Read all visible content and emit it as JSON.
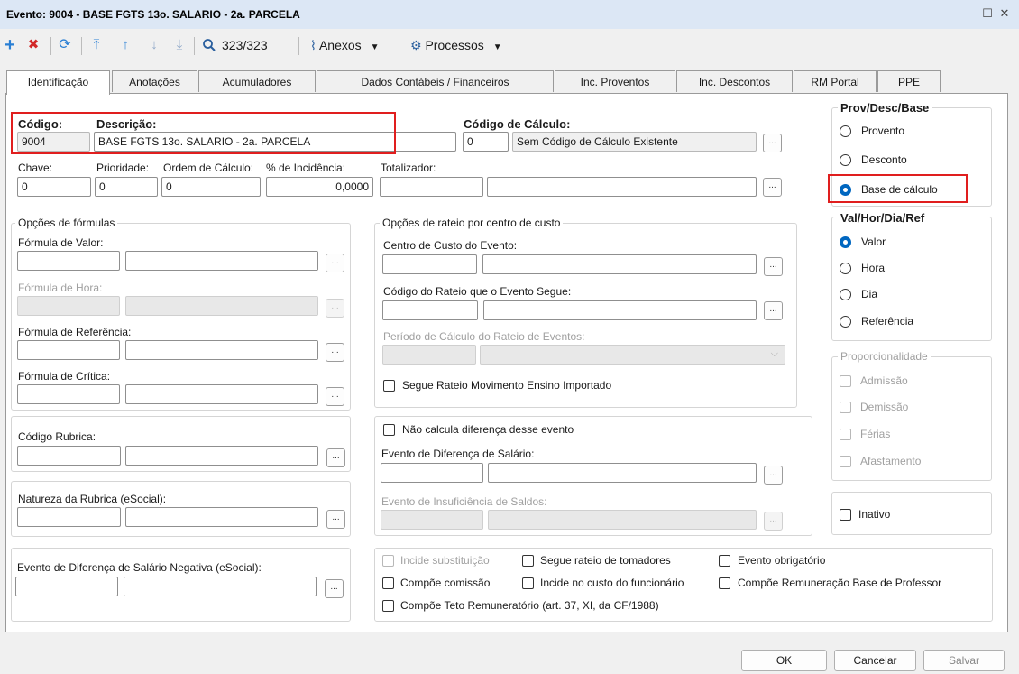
{
  "window": {
    "title": "Evento: 9004 - BASE FGTS 13o. SALARIO - 2a. PARCELA",
    "restore_glyph": "☐",
    "close_glyph": "✕"
  },
  "toolbar": {
    "add": "+",
    "delete": "✖",
    "refresh": "⟳",
    "first": "⤒",
    "prev": "↑",
    "next": "↓",
    "last": "⤓",
    "search_icon": "🔍",
    "record_count": "323/323",
    "attachments_label": "Anexos",
    "processes_label": "Processos",
    "dropdown_glyph": "▼",
    "colors": {
      "add": "#2a7fd4",
      "delete": "#d22828",
      "nav": "#2a7fd4"
    }
  },
  "tabs": [
    "Identificação",
    "Anotações",
    "Acumuladores",
    "Dados Contábeis / Financeiros",
    "Inc. Proventos",
    "Inc. Descontos",
    "RM Portal",
    "PPE"
  ],
  "ident": {
    "codigo_label": "Código:",
    "codigo_value": "9004",
    "descricao_label": "Descrição:",
    "descricao_value": "BASE FGTS 13o. SALARIO - 2a. PARCELA",
    "calc_label": "Código de Cálculo:",
    "calc_code": "0",
    "calc_desc": "Sem Código de Cálculo Existente",
    "chave_label": "Chave:",
    "chave_value": "0",
    "prioridade_label": "Prioridade:",
    "prioridade_value": "0",
    "ordem_label": "Ordem de Cálculo:",
    "ordem_value": "0",
    "incidencia_label": "% de Incidência:",
    "incidencia_value": "0,0000",
    "totalizador_label": "Totalizador:",
    "ellipsis": "..."
  },
  "prov": {
    "title": "Prov/Desc/Base",
    "options": [
      "Provento",
      "Desconto",
      "Base de cálculo"
    ],
    "selected": "Base de cálculo"
  },
  "val": {
    "title": "Val/Hor/Dia/Ref",
    "options": [
      "Valor",
      "Hora",
      "Dia",
      "Referência"
    ],
    "selected": "Valor"
  },
  "prop": {
    "title": "Proporcionalidade",
    "options": [
      "Admissão",
      "Demissão",
      "Férias",
      "Afastamento"
    ]
  },
  "inativo": "Inativo",
  "formulas": {
    "title": "Opções de fórmulas",
    "valor": "Fórmula de Valor:",
    "hora": "Fórmula de Hora:",
    "referencia": "Fórmula de Referência:",
    "critica": "Fórmula de Crítica:"
  },
  "rubrica": "Código Rubrica:",
  "natureza": "Natureza da Rubrica (eSocial):",
  "dif_negativa": "Evento de Diferença de Salário Negativa (eSocial):",
  "rateio": {
    "title": "Opções de rateio por centro de custo",
    "centro": "Centro de Custo do Evento:",
    "codigo_rateio": "Código do Rateio que o Evento Segue:",
    "periodo": "Período de Cálculo do Rateio de Eventos:",
    "segue_ensino": "Segue Rateio Movimento Ensino Importado",
    "combo_arrow": "⌵"
  },
  "diferenca": {
    "nao_calcula": "Não calcula diferença desse evento",
    "evento_dif": "Evento de Diferença de Salário:",
    "evento_insuf": "Evento de Insuficiência de Saldos:"
  },
  "checks": {
    "incide_subst": "Incide substituição",
    "segue_tomadores": "Segue rateio de tomadores",
    "obrigatorio": "Evento obrigatório",
    "comissao": "Compõe comissão",
    "custo_func": "Incide no custo do funcionário",
    "rem_professor": "Compõe Remuneração Base de Professor",
    "teto": "Compõe Teto Remuneratório (art. 37, XI, da CF/1988)"
  },
  "buttons": {
    "ok": "OK",
    "cancel": "Cancelar",
    "save": "Salvar"
  }
}
